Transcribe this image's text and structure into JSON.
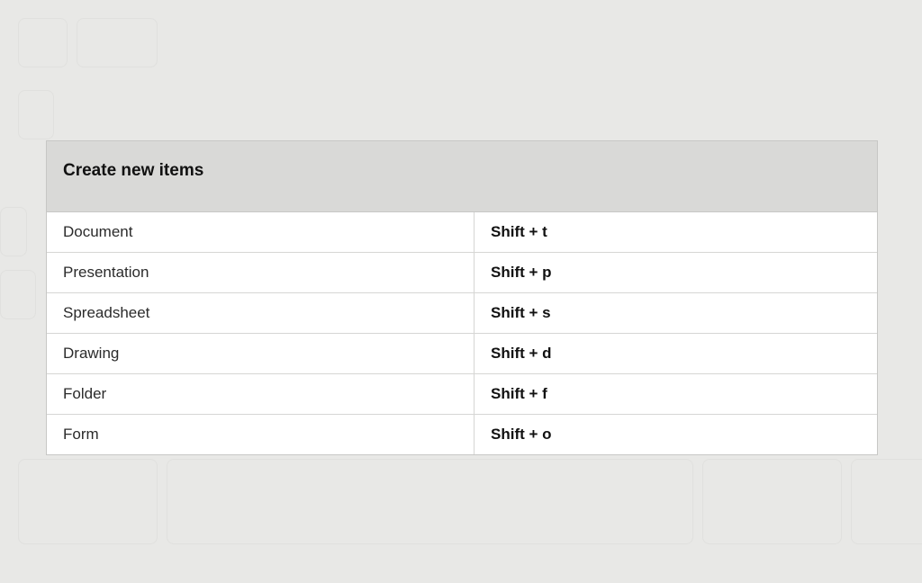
{
  "table": {
    "header": "Create new items",
    "rows": [
      {
        "action": "Document",
        "shortcut": "Shift + t"
      },
      {
        "action": "Presentation",
        "shortcut": "Shift + p"
      },
      {
        "action": "Spreadsheet",
        "shortcut": "Shift + s"
      },
      {
        "action": "Drawing",
        "shortcut": "Shift + d"
      },
      {
        "action": "Folder",
        "shortcut": "Shift + f"
      },
      {
        "action": "Form",
        "shortcut": "Shift + o"
      }
    ]
  }
}
